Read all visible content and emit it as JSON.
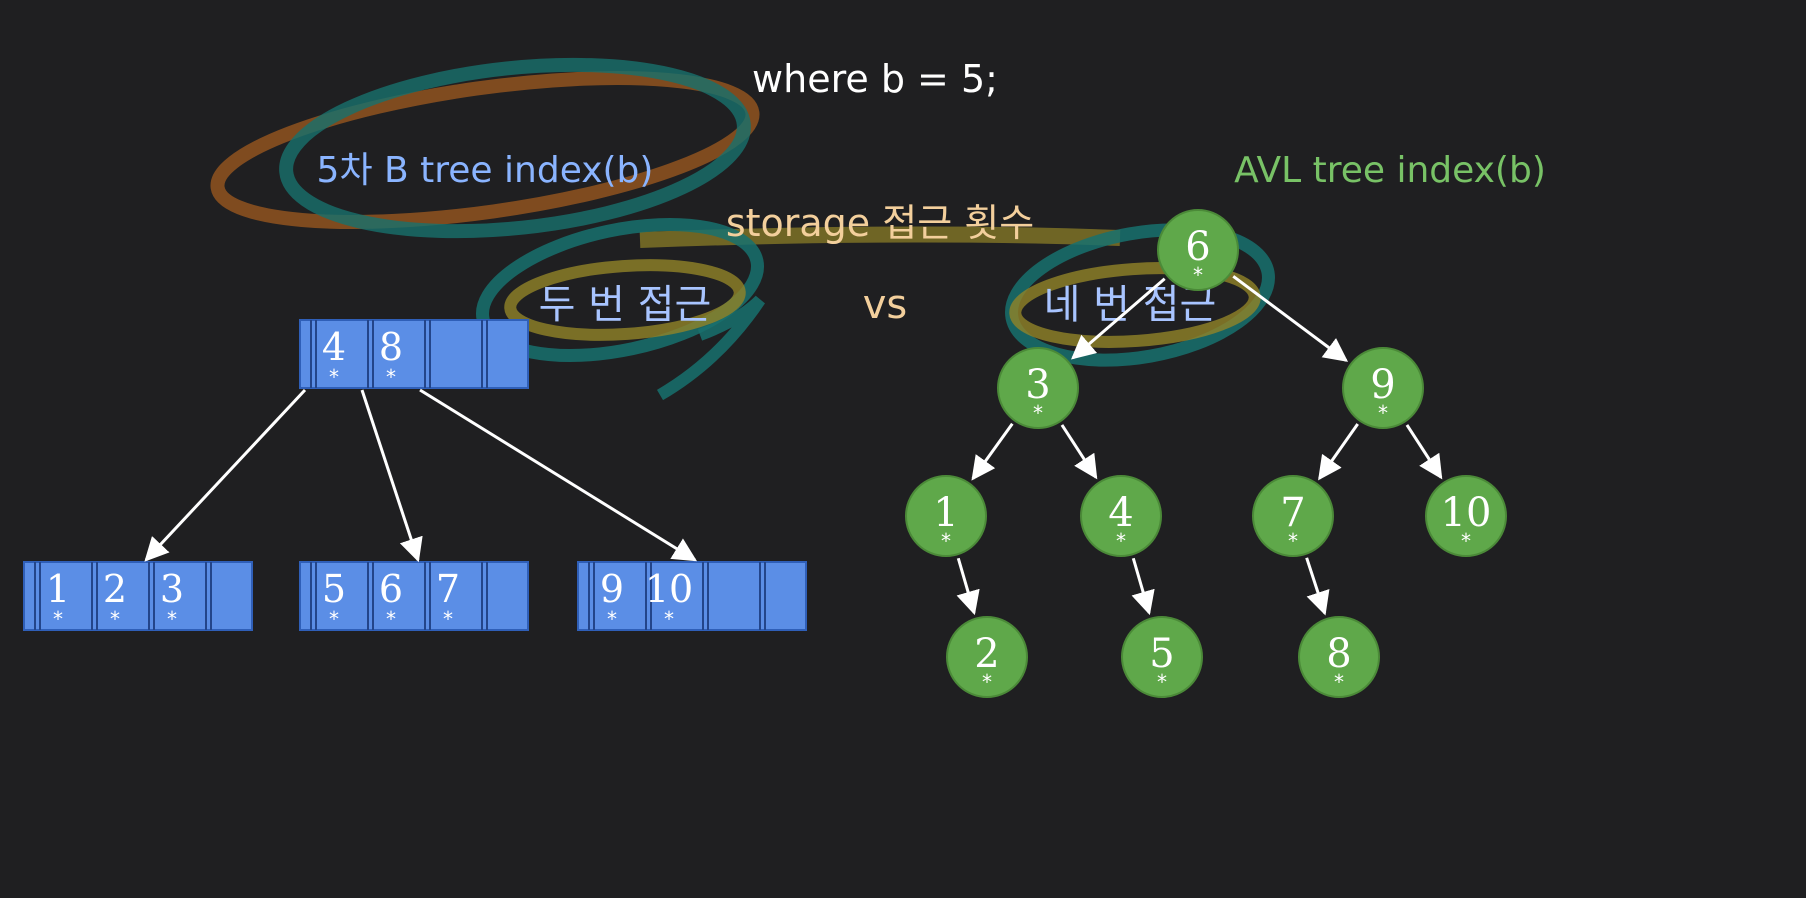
{
  "query": "where b = 5;",
  "btree": {
    "title": "5차 B tree index(b)",
    "access_label": "두 번 접근",
    "root": {
      "keys": [
        "4",
        "8"
      ],
      "slots": 4
    },
    "leaves": [
      {
        "keys": [
          "1",
          "2",
          "3"
        ],
        "slots": 4
      },
      {
        "keys": [
          "5",
          "6",
          "7"
        ],
        "slots": 4
      },
      {
        "keys": [
          "9",
          "10"
        ],
        "slots": 4
      }
    ],
    "pointer_mark": "*"
  },
  "comparison": {
    "title": "storage 접근 횟수",
    "vs": "vs"
  },
  "avl": {
    "title": "AVL tree index(b)",
    "access_label": "네 번 접근",
    "nodes": [
      {
        "id": "n6",
        "key": "6",
        "parent": null
      },
      {
        "id": "n3",
        "key": "3",
        "parent": "n6"
      },
      {
        "id": "n9",
        "key": "9",
        "parent": "n6"
      },
      {
        "id": "n1",
        "key": "1",
        "parent": "n3"
      },
      {
        "id": "n4",
        "key": "4",
        "parent": "n3"
      },
      {
        "id": "n7",
        "key": "7",
        "parent": "n9"
      },
      {
        "id": "n10",
        "key": "10",
        "parent": "n9"
      },
      {
        "id": "n2",
        "key": "2",
        "parent": "n1"
      },
      {
        "id": "n5",
        "key": "5",
        "parent": "n4"
      },
      {
        "id": "n8",
        "key": "8",
        "parent": "n7"
      }
    ],
    "pointer_mark": "*"
  },
  "colors": {
    "background": "#1f1f21",
    "btree_node": "#5b8ee6",
    "avl_node": "#5fa84a",
    "highlight_teal": "#1a8f8a",
    "highlight_orange": "#c86a1e",
    "highlight_yellow": "#b9a620"
  }
}
